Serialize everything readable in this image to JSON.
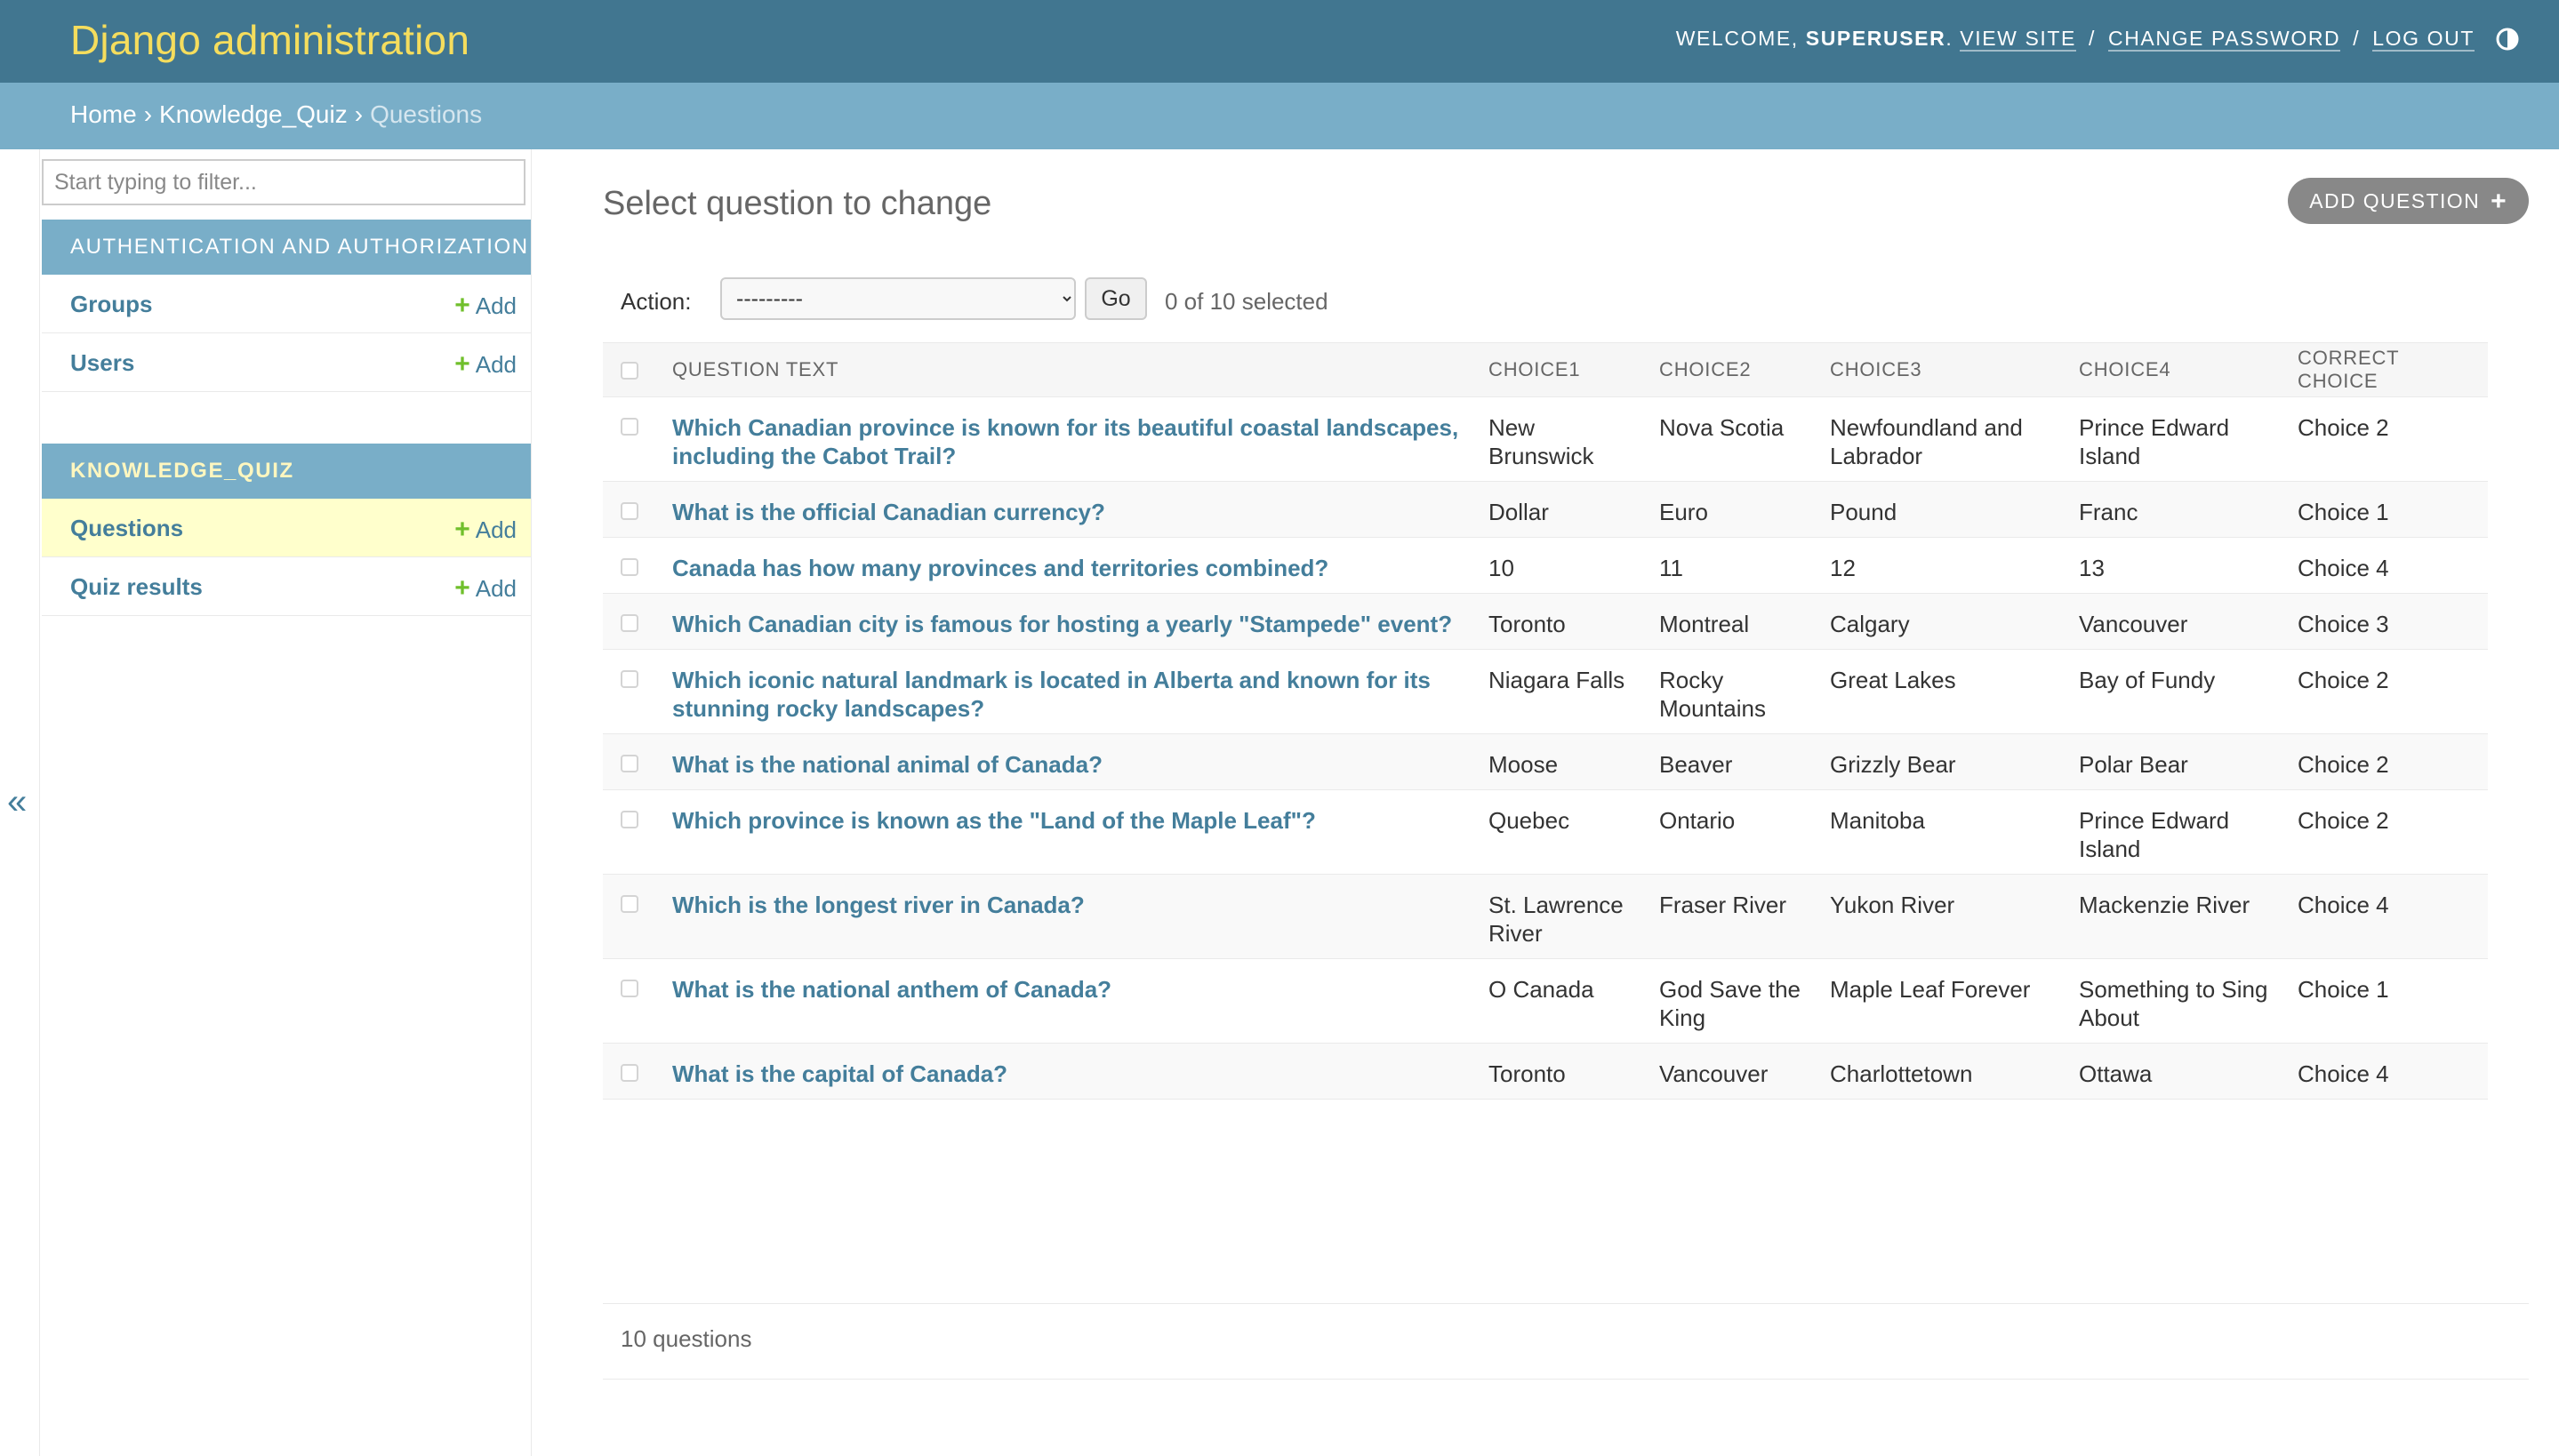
{
  "header": {
    "brand": "Django administration",
    "welcome": "Welcome,",
    "username": "superuser",
    "view_site": "View site",
    "change_password": "Change password",
    "log_out": "Log out",
    "separator": "/"
  },
  "breadcrumbs": {
    "home": "Home",
    "app": "Knowledge_Quiz",
    "current": "Questions",
    "separator": "›"
  },
  "sidebar": {
    "filter_placeholder": "Start typing to filter...",
    "collapse_label": "«",
    "add_label": "Add",
    "apps": [
      {
        "caption": "Authentication and Authorization",
        "models": [
          {
            "name": "Groups"
          },
          {
            "name": "Users"
          }
        ]
      },
      {
        "caption": "Knowledge_Quiz",
        "models": [
          {
            "name": "Questions"
          },
          {
            "name": "Quiz results"
          }
        ]
      }
    ]
  },
  "main": {
    "title": "Select question to change",
    "add_button": "Add question",
    "actions": {
      "label": "Action:",
      "selected_option": "---------",
      "go": "Go",
      "counter": "0 of 10 selected"
    },
    "table": {
      "columns": [
        "Question text",
        "Choice1",
        "Choice2",
        "Choice3",
        "Choice4",
        "Correct choice"
      ],
      "rows": [
        [
          "Which Canadian province is known for its beautiful coastal landscapes, including the Cabot Trail?",
          "New Brunswick",
          "Nova Scotia",
          "Newfoundland and Labrador",
          "Prince Edward Island",
          "Choice 2"
        ],
        [
          "What is the official Canadian currency?",
          "Dollar",
          "Euro",
          "Pound",
          "Franc",
          "Choice 1"
        ],
        [
          "Canada has how many provinces and territories combined?",
          "10",
          "11",
          "12",
          "13",
          "Choice 4"
        ],
        [
          "Which Canadian city is famous for hosting a yearly \"Stampede\" event?",
          "Toronto",
          "Montreal",
          "Calgary",
          "Vancouver",
          "Choice 3"
        ],
        [
          "Which iconic natural landmark is located in Alberta and known for its stunning rocky landscapes?",
          "Niagara Falls",
          "Rocky Mountains",
          "Great Lakes",
          "Bay of Fundy",
          "Choice 2"
        ],
        [
          "What is the national animal of Canada?",
          "Moose",
          "Beaver",
          "Grizzly Bear",
          "Polar Bear",
          "Choice 2"
        ],
        [
          "Which province is known as the \"Land of the Maple Leaf\"?",
          "Quebec",
          "Ontario",
          "Manitoba",
          "Prince Edward Island",
          "Choice 2"
        ],
        [
          "Which is the longest river in Canada?",
          "St. Lawrence River",
          "Fraser River",
          "Yukon River",
          "Mackenzie River",
          "Choice 4"
        ],
        [
          "What is the national anthem of Canada?",
          "O Canada",
          "God Save the King",
          "Maple Leaf Forever",
          "Something to Sing About",
          "Choice 1"
        ],
        [
          "What is the capital of Canada?",
          "Toronto",
          "Vancouver",
          "Charlottetown",
          "Ottawa",
          "Choice 4"
        ]
      ]
    },
    "paginator": "10 questions"
  },
  "colors": {
    "header_bg": "#417690",
    "brand": "#f5dd5d",
    "breadcrumbs_bg": "#79aec8",
    "link": "#447e9b",
    "add_plus": "#70bf2b",
    "selected_row": "#ffffcc"
  },
  "icons": {
    "theme_toggle": "half-circle-contrast-icon",
    "add": "plus-icon",
    "collapse": "double-chevron-left-icon"
  }
}
